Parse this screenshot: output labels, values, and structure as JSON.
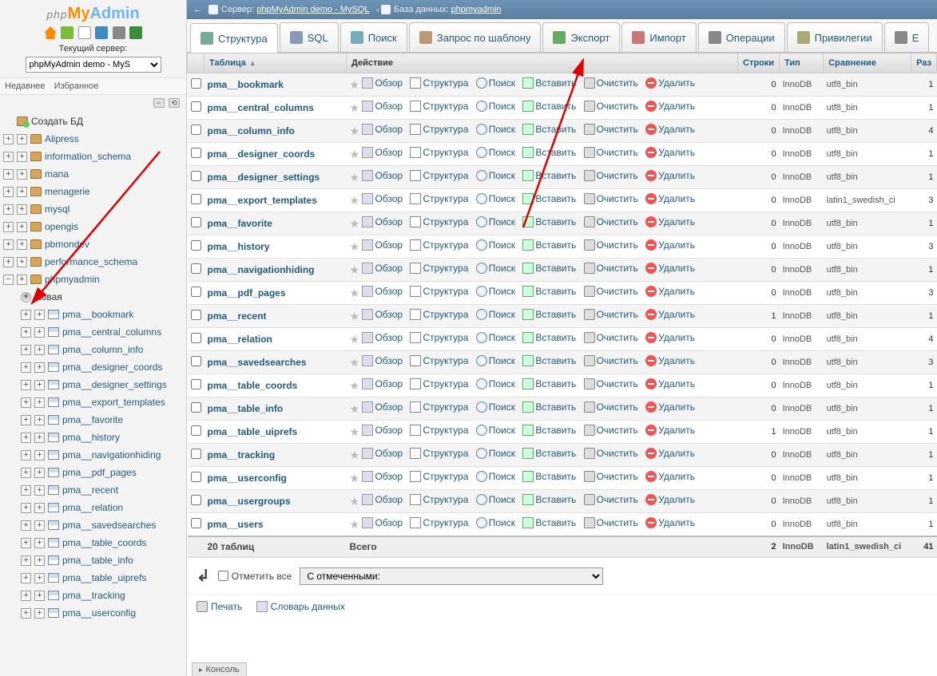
{
  "logo": {
    "p1": "php",
    "p2": "My",
    "p3": "Admin"
  },
  "sidebar": {
    "current_server_label": "Текущий сервер:",
    "server_selected": "phpMyAdmin demo - MyS",
    "recent": "Недавнее",
    "favorites": "Избранное",
    "new_db": "Создать БД",
    "new_table": "Новая",
    "databases": [
      {
        "name": "Alipress"
      },
      {
        "name": "information_schema"
      },
      {
        "name": "mana"
      },
      {
        "name": "menagerie"
      },
      {
        "name": "mysql"
      },
      {
        "name": "opengis"
      },
      {
        "name": "pbmondev"
      },
      {
        "name": "performance_schema"
      },
      {
        "name": "phpmyadmin"
      }
    ],
    "tables": [
      "pma__bookmark",
      "pma__central_columns",
      "pma__column_info",
      "pma__designer_coords",
      "pma__designer_settings",
      "pma__export_templates",
      "pma__favorite",
      "pma__history",
      "pma__navigationhiding",
      "pma__pdf_pages",
      "pma__recent",
      "pma__relation",
      "pma__savedsearches",
      "pma__table_coords",
      "pma__table_info",
      "pma__table_uiprefs",
      "pma__tracking",
      "pma__userconfig"
    ]
  },
  "breadcrumb": {
    "server_label": "Сервер:",
    "server_value": "phpMyAdmin demo - MySQL",
    "db_label": "База данных:",
    "db_value": "phpmyadmin",
    "sep": "»"
  },
  "tabs": [
    {
      "label": "Структура",
      "icon": "structure-icon"
    },
    {
      "label": "SQL",
      "icon": "sql-icon"
    },
    {
      "label": "Поиск",
      "icon": "search-icon"
    },
    {
      "label": "Запрос по шаблону",
      "icon": "query-icon"
    },
    {
      "label": "Экспорт",
      "icon": "export-icon"
    },
    {
      "label": "Импорт",
      "icon": "import-icon"
    },
    {
      "label": "Операции",
      "icon": "operations-icon"
    },
    {
      "label": "Привилегии",
      "icon": "privileges-icon"
    },
    {
      "label": "Е",
      "icon": "more-icon"
    }
  ],
  "headers": {
    "table": "Таблица",
    "action": "Действие",
    "rows": "Строки",
    "type": "Тип",
    "collation": "Сравнение",
    "size": "Раз"
  },
  "actions": {
    "browse": "Обзор",
    "structure": "Структура",
    "search": "Поиск",
    "insert": "Вставить",
    "empty": "Очистить",
    "drop": "Удалить"
  },
  "rows": [
    {
      "name": "pma__bookmark",
      "rows": 0,
      "type": "InnoDB",
      "collation": "utf8_bin",
      "size": 1
    },
    {
      "name": "pma__central_columns",
      "rows": 0,
      "type": "InnoDB",
      "collation": "utf8_bin",
      "size": 1
    },
    {
      "name": "pma__column_info",
      "rows": 0,
      "type": "InnoDB",
      "collation": "utf8_bin",
      "size": 4
    },
    {
      "name": "pma__designer_coords",
      "rows": 0,
      "type": "InnoDB",
      "collation": "utf8_bin",
      "size": 1
    },
    {
      "name": "pma__designer_settings",
      "rows": 0,
      "type": "InnoDB",
      "collation": "utf8_bin",
      "size": 1
    },
    {
      "name": "pma__export_templates",
      "rows": 0,
      "type": "InnoDB",
      "collation": "latin1_swedish_ci",
      "size": 3
    },
    {
      "name": "pma__favorite",
      "rows": 0,
      "type": "InnoDB",
      "collation": "utf8_bin",
      "size": 1
    },
    {
      "name": "pma__history",
      "rows": 0,
      "type": "InnoDB",
      "collation": "utf8_bin",
      "size": 3
    },
    {
      "name": "pma__navigationhiding",
      "rows": 0,
      "type": "InnoDB",
      "collation": "utf8_bin",
      "size": 1
    },
    {
      "name": "pma__pdf_pages",
      "rows": 0,
      "type": "InnoDB",
      "collation": "utf8_bin",
      "size": 3
    },
    {
      "name": "pma__recent",
      "rows": 1,
      "type": "InnoDB",
      "collation": "utf8_bin",
      "size": 1
    },
    {
      "name": "pma__relation",
      "rows": 0,
      "type": "InnoDB",
      "collation": "utf8_bin",
      "size": 4
    },
    {
      "name": "pma__savedsearches",
      "rows": 0,
      "type": "InnoDB",
      "collation": "utf8_bin",
      "size": 3
    },
    {
      "name": "pma__table_coords",
      "rows": 0,
      "type": "InnoDB",
      "collation": "utf8_bin",
      "size": 1
    },
    {
      "name": "pma__table_info",
      "rows": 0,
      "type": "InnoDB",
      "collation": "utf8_bin",
      "size": 1
    },
    {
      "name": "pma__table_uiprefs",
      "rows": 1,
      "type": "InnoDB",
      "collation": "utf8_bin",
      "size": 1
    },
    {
      "name": "pma__tracking",
      "rows": 0,
      "type": "InnoDB",
      "collation": "utf8_bin",
      "size": 1
    },
    {
      "name": "pma__userconfig",
      "rows": 0,
      "type": "InnoDB",
      "collation": "utf8_bin",
      "size": 1
    },
    {
      "name": "pma__usergroups",
      "rows": 0,
      "type": "InnoDB",
      "collation": "utf8_bin",
      "size": 1
    },
    {
      "name": "pma__users",
      "rows": 0,
      "type": "InnoDB",
      "collation": "utf8_bin",
      "size": 1
    }
  ],
  "totals": {
    "tables_label": "20 таблиц",
    "sum_label": "Всего",
    "rows": 2,
    "type": "InnoDB",
    "collation": "latin1_swedish_ci",
    "size": 41
  },
  "check_all": "Отметить все",
  "bulk_placeholder": "С отмеченными:",
  "footer": {
    "print": "Печать",
    "dictionary": "Словарь данных"
  },
  "console": "Консоль"
}
